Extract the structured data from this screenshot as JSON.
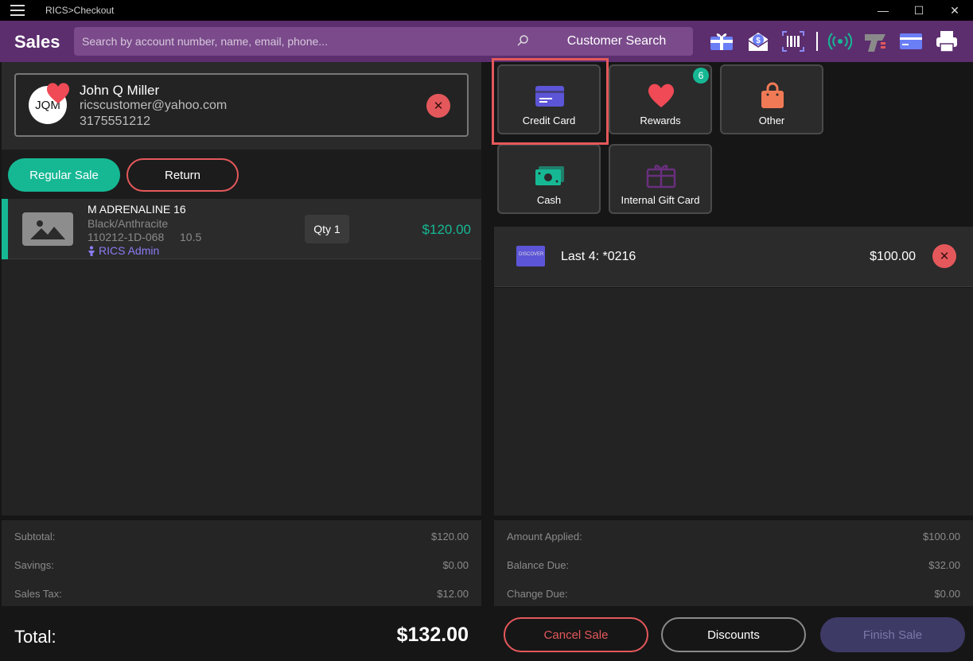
{
  "window": {
    "title": "RICS>Checkout",
    "minimize": "—",
    "maximize": "☐",
    "close": "✕"
  },
  "header": {
    "title": "Sales",
    "search_placeholder": "Search by account number, name, email, phone...",
    "customer_search_label": "Customer Search",
    "icons": [
      "gift-card-icon",
      "cash-envelope-icon",
      "barcode-scan-icon",
      "wireless-signal-icon",
      "card-reader-icon",
      "credit-card-icon",
      "printer-icon"
    ]
  },
  "customer": {
    "initials": "JQM",
    "name": "John Q Miller",
    "email": "ricscustomer@yahoo.com",
    "phone": "3175551212",
    "remove": "✕"
  },
  "sale_modes": {
    "regular": "Regular Sale",
    "return": "Return"
  },
  "line_items": [
    {
      "name": "M ADRENALINE 16",
      "color": "Black/Anthracite",
      "sku": "110212-1D-068",
      "size": "10.5",
      "salesperson": "RICS Admin",
      "qty": "Qty 1",
      "price": "$120.00"
    }
  ],
  "totals": {
    "subtotal_label": "Subtotal:",
    "subtotal": "$120.00",
    "savings_label": "Savings:",
    "savings": "$0.00",
    "tax_label": "Sales Tax:",
    "tax": "$12.00",
    "total_label": "Total:",
    "total": "$132.00"
  },
  "tenders": [
    {
      "label": "Credit Card",
      "icon": "credit-card-icon",
      "selected": true
    },
    {
      "label": "Rewards",
      "icon": "heart-icon",
      "badge": "6"
    },
    {
      "label": "Other",
      "icon": "shopping-bag-icon"
    },
    {
      "label": "Cash",
      "icon": "cash-icon"
    },
    {
      "label": "Internal Gift Card",
      "icon": "gift-card-icon"
    }
  ],
  "payments": [
    {
      "card_brand": "DISCOVER",
      "last4": "Last 4: *0216",
      "amount": "$100.00",
      "remove": "✕"
    }
  ],
  "payment_totals": {
    "applied_label": "Amount Applied:",
    "applied": "$100.00",
    "balance_label": "Balance Due:",
    "balance": "$32.00",
    "change_label": "Change Due:",
    "change": "$0.00"
  },
  "actions": {
    "cancel": "Cancel Sale",
    "discounts": "Discounts",
    "finish": "Finish Sale"
  },
  "colors": {
    "header": "#5c2e6e",
    "accent_green": "#16b894",
    "accent_red": "#e4585b",
    "card_purple": "#5d55d8"
  }
}
